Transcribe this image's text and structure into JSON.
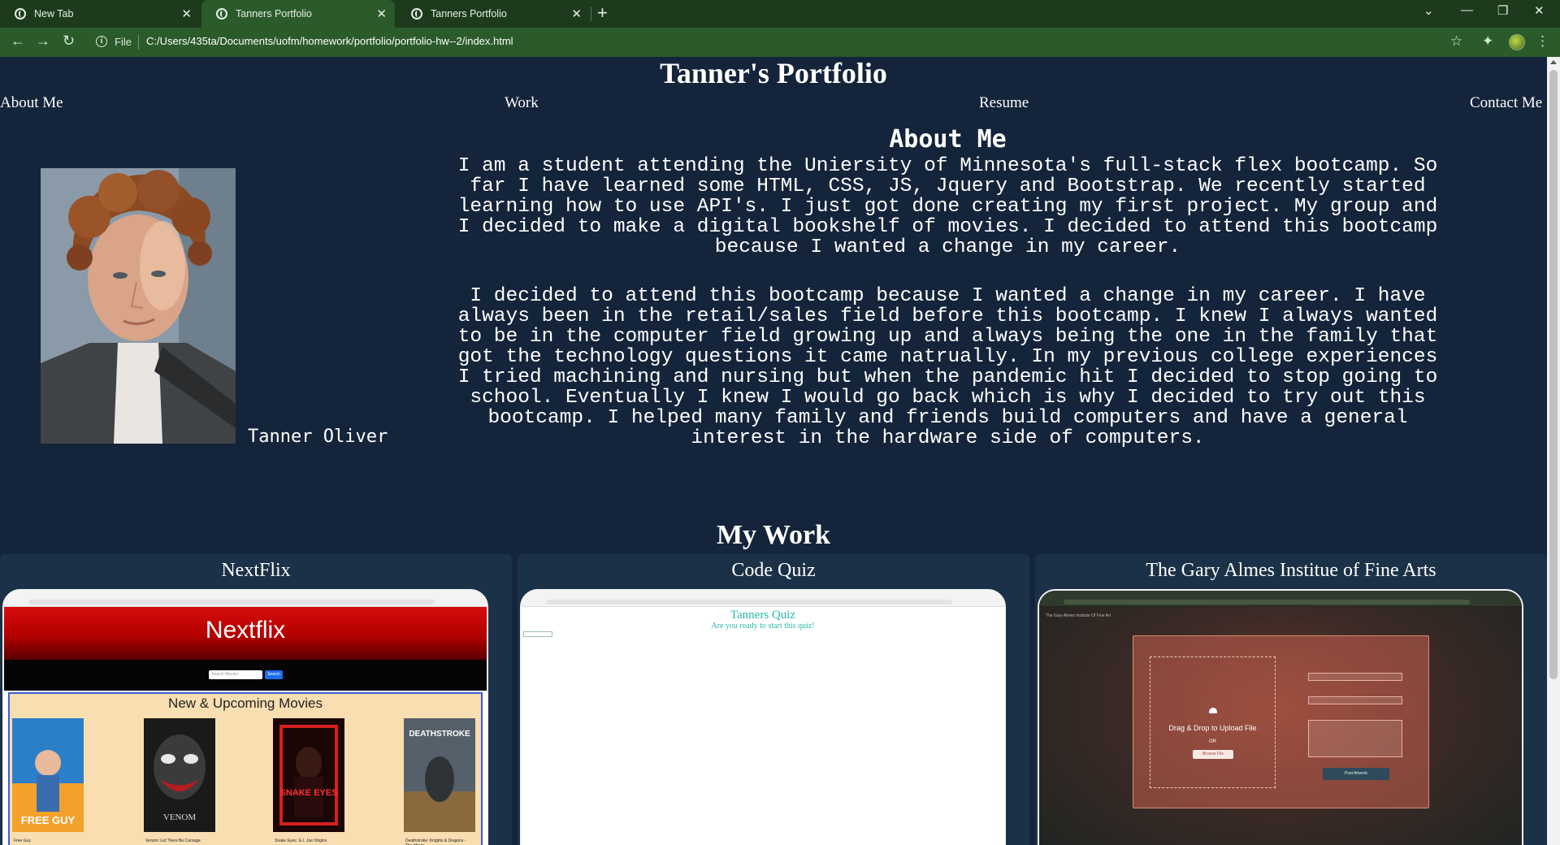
{
  "browser": {
    "tabs": [
      {
        "title": "New Tab"
      },
      {
        "title": "Tanners Portfolio"
      },
      {
        "title": "Tanners Portfolio"
      }
    ],
    "url_scheme_label": "File",
    "url": "C:/Users/435ta/Documents/uofm/homework/portfolio/portfolio-hw--2/index.html"
  },
  "site": {
    "title": "Tanner's Portfolio",
    "nav": [
      "About Me",
      "Work",
      "Resume",
      "Contact Me"
    ]
  },
  "about": {
    "heading": "About Me",
    "name": "Tanner Oliver",
    "paragraph1_lines": [
      "I am a student attending the Uniersity of Minnesota's full-stack flex bootcamp. So",
      "far I have learned some HTML, CSS, JS, Jquery and Bootstrap. We recently started",
      "learning how to use API's. I just got done creating my first project. My group and",
      "I decided to make a digital bookshelf of movies. I decided to attend this bootcamp",
      "because I wanted a change in my career."
    ],
    "paragraph2_lines": [
      "I decided to attend this bootcamp because I wanted a change in my career. I have",
      "always been in the retail/sales field before this bootcamp. I knew I always wanted",
      "to be in the computer field growing up and always being the one in the family that",
      "got the technology questions it came natrually. In my previous college experiences",
      "I tried machining and nursing but when the pandemic hit I decided to stop going to",
      "school. Eventually I knew I would go back which is why I decided to try out this",
      "bootcamp. I helped many family and friends build computers and have a general",
      "interest in the hardware side of computers."
    ]
  },
  "work": {
    "heading": "My Work",
    "projects": [
      {
        "title": "NextFlix",
        "shot": {
          "logo": "Nextflix",
          "search_placeholder": "Search Movies",
          "search_button": "Search",
          "section_heading": "New & Upcoming Movies",
          "posters": [
            {
              "caption": "Free Guy",
              "art_text": "FREE GUY"
            },
            {
              "caption": "Venom: Let There Be Carnage",
              "art_text": "VENOM"
            },
            {
              "caption": "Snake Eyes: G.I. Joe Origins",
              "art_text": "SNAKE EYES"
            },
            {
              "caption": "Deathstroke: Knights & Dragons - The Movie",
              "art_text": "DEATHSTROKE"
            }
          ]
        }
      },
      {
        "title": "Code Quiz",
        "shot": {
          "heading": "Tanners Quiz",
          "subheading": "Are you ready to start this quiz!"
        }
      },
      {
        "title": "The Gary Almes Institue of Fine Arts",
        "shot": {
          "nav_text": "The Gary Almes Institute Of Fine Art",
          "drop_text": "Drag & Drop to Upload File",
          "or_text": "OR",
          "browse_label": "Browse File",
          "submit_label": "Post Artwork"
        }
      }
    ]
  },
  "colors": {
    "page_bg": "#14243a",
    "card_bg": "#1b3147",
    "chrome_tabstrip": "#1d3a1d",
    "chrome_toolbar": "#2b5a2b",
    "quiz_accent": "#2ab8a8"
  }
}
